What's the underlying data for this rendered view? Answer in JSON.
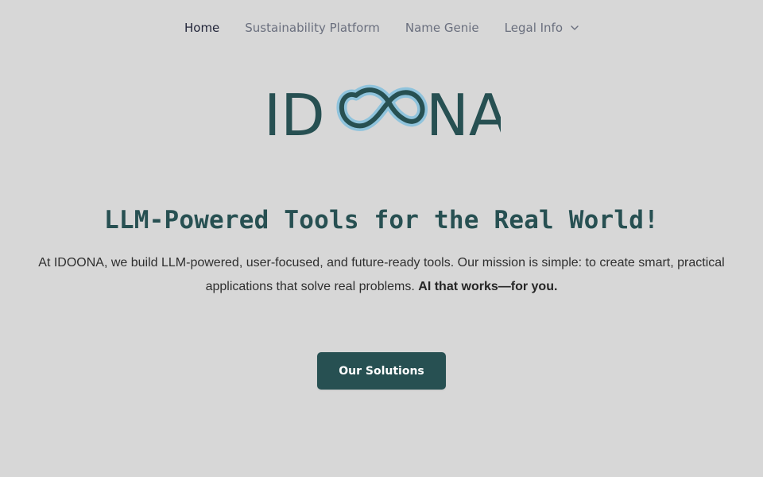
{
  "nav": {
    "items": [
      {
        "label": "Home",
        "active": true
      },
      {
        "label": "Sustainability Platform",
        "active": false
      },
      {
        "label": "Name Genie",
        "active": false
      },
      {
        "label": "Legal Info",
        "active": false,
        "icon": "chevron-down-icon"
      }
    ]
  },
  "logo": {
    "text_left": "ID",
    "text_right": "NA",
    "symbol": "infinity",
    "brand_color": "#275052",
    "accent_color": "#8fc3dc"
  },
  "hero": {
    "title": "LLM-Powered Tools for the Real World!",
    "text_main": "At IDOONA, we build LLM-powered, user-focused, and future-ready tools. Our mission is simple: to create smart, practical applications that solve real problems.",
    "text_bold": "AI that works—for you."
  },
  "cta": {
    "label": "Our Solutions"
  },
  "colors": {
    "background": "#d7d7d7",
    "primary": "#275052",
    "nav_inactive": "#6a6f7e",
    "nav_active": "#23263a"
  }
}
